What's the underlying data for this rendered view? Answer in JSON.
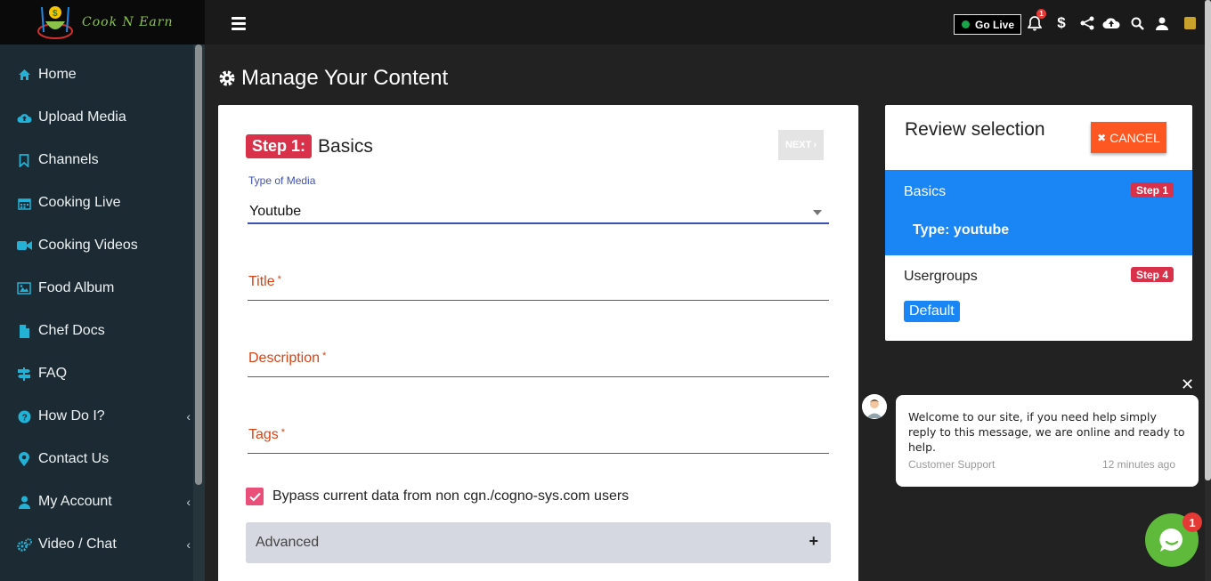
{
  "brand": {
    "name": "Cook N Earn"
  },
  "sidebar": {
    "items": [
      {
        "label": "Home",
        "icon": "home-icon"
      },
      {
        "label": "Upload Media",
        "icon": "cloud-upload-icon"
      },
      {
        "label": "Channels",
        "icon": "bookmark-icon"
      },
      {
        "label": "Cooking Live",
        "icon": "calendar-icon"
      },
      {
        "label": "Cooking Videos",
        "icon": "video-camera-icon"
      },
      {
        "label": "Food Album",
        "icon": "image-icon"
      },
      {
        "label": "Chef Docs",
        "icon": "document-icon"
      },
      {
        "label": "FAQ",
        "icon": "signpost-icon"
      },
      {
        "label": "How Do I?",
        "icon": "question-circle-icon",
        "expandable": true
      },
      {
        "label": "Contact Us",
        "icon": "map-marker-icon"
      },
      {
        "label": "My Account",
        "icon": "user-icon",
        "expandable": true
      },
      {
        "label": "Video / Chat",
        "icon": "cogs-icon",
        "expandable": true
      }
    ]
  },
  "topbar": {
    "go_live": "Go Live",
    "notifications_count": "1"
  },
  "page": {
    "title": "Manage Your Content"
  },
  "form": {
    "step_badge": "Step 1:",
    "step_title": "Basics",
    "next_label": "NEXT",
    "media_type_label": "Type of Media",
    "media_type_value": "Youtube",
    "title_label": "Title",
    "description_label": "Description",
    "tags_label": "Tags",
    "required_mark": "*",
    "bypass_label": "Bypass current data from non cgn./cogno-sys.com users",
    "bypass_checked": true,
    "advanced_label": "Advanced"
  },
  "review": {
    "title": "Review selection",
    "cancel_label": "CANCEL",
    "basics": {
      "label": "Basics",
      "badge": "Step 1",
      "summary": "Type: youtube"
    },
    "usergroups": {
      "label": "Usergroups",
      "badge": "Step 4",
      "value": "Default"
    }
  },
  "chat": {
    "message": "Welcome to our site, if you need help simply reply to this message, we are online and ready to help.",
    "from": "Customer Support",
    "time": "12 minutes ago",
    "unread": "1"
  },
  "colors": {
    "sidebar_bg": "#1c2b33",
    "accent_blue": "#1a86f5",
    "danger": "#d9314a",
    "cancel_orange": "#ff5722",
    "chat_green": "#5fba3b"
  }
}
